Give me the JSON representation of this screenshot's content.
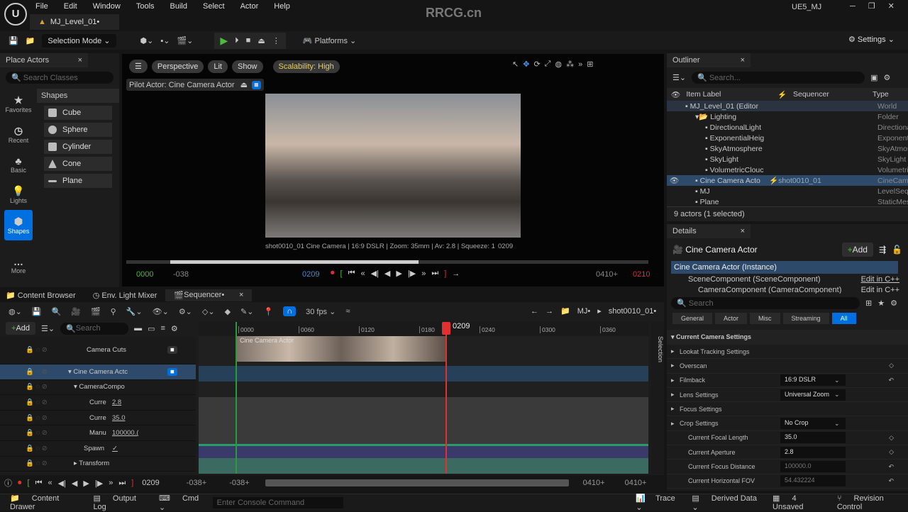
{
  "app": {
    "menus": [
      "File",
      "Edit",
      "Window",
      "Tools",
      "Build",
      "Select",
      "Actor",
      "Help"
    ],
    "level_tab": "MJ_Level_01•",
    "project": "UE5_MJ",
    "watermark": "RRCG.cn"
  },
  "toolbar": {
    "selection_mode": "Selection Mode",
    "platforms": "Platforms",
    "settings": "Settings"
  },
  "place_actors": {
    "title": "Place Actors",
    "search_placeholder": "Search Classes",
    "section": "Shapes",
    "categories": [
      "Favorites",
      "Recent",
      "Basic",
      "Lights",
      "Shapes",
      "More"
    ],
    "shapes": [
      "Cube",
      "Sphere",
      "Cylinder",
      "Cone",
      "Plane"
    ]
  },
  "viewport": {
    "perspective": "Perspective",
    "lit": "Lit",
    "show": "Show",
    "scalability": "Scalability: High",
    "pilot": "Pilot Actor: Cine Camera Actor",
    "overlay": "shot0010_01 Cine Camera | 16:9 DSLR | Zoom: 35mm | Av: 2.8 | Squeeze: 1",
    "overlay_frame": "0209",
    "start": "0000",
    "minus1": "-038",
    "current": "0209",
    "end_a": "0410+",
    "end_b": "0210"
  },
  "outliner": {
    "title": "Outliner",
    "search_placeholder": "Search...",
    "col_label": "Item Label",
    "col_seq": "Sequencer",
    "col_type": "Type",
    "rows": [
      {
        "label": "MJ_Level_01 (Editor",
        "type": "World",
        "indent": 1
      },
      {
        "label": "Lighting",
        "type": "Folder",
        "indent": 2
      },
      {
        "label": "DirectionalLight",
        "type": "Directiona",
        "indent": 3
      },
      {
        "label": "ExponentialHeig",
        "type": "Exponenti",
        "indent": 3
      },
      {
        "label": "SkyAtmosphere",
        "type": "SkyAtmos",
        "indent": 3
      },
      {
        "label": "SkyLight",
        "type": "SkyLight",
        "indent": 3
      },
      {
        "label": "VolumetricClouc",
        "type": "Volumetri",
        "indent": 3
      },
      {
        "label": "Cine Camera Acto",
        "seq": "shot0010_01",
        "type": "CineCame",
        "indent": 2,
        "selected": true
      },
      {
        "label": "MJ",
        "type": "LevelSequ",
        "indent": 2
      },
      {
        "label": "Plane",
        "type": "StaticMes",
        "indent": 2
      }
    ],
    "footer": "9 actors (1 selected)"
  },
  "details": {
    "title": "Details",
    "actor": "Cine Camera Actor",
    "add": "Add",
    "instance": "Cine Camera Actor (Instance)",
    "components": [
      {
        "name": "SceneComponent (SceneComponent)",
        "edit": "Edit in C++"
      },
      {
        "name": "CameraComponent (CameraComponent)",
        "edit": "Edit in C++"
      }
    ],
    "search_placeholder": "Search",
    "filters": [
      "General",
      "Actor",
      "Misc",
      "Streaming",
      "All"
    ],
    "active_filter": "All",
    "section": "Current Camera Settings",
    "props": [
      {
        "label": "Lookat Tracking Settings"
      },
      {
        "label": "Overscan"
      },
      {
        "label": "Filmback",
        "value": "16:9 DSLR"
      },
      {
        "label": "Lens Settings",
        "value": "Universal Zoom"
      },
      {
        "label": "Focus Settings"
      },
      {
        "label": "Crop Settings",
        "value": "No Crop"
      },
      {
        "label": "Current Focal Length",
        "value": "35.0"
      },
      {
        "label": "Current Aperture",
        "value": "2.8"
      },
      {
        "label": "Current Focus Distance",
        "value": "100000.0"
      },
      {
        "label": "Current Horizontal FOV",
        "value": "54.432224"
      }
    ]
  },
  "bottom_tabs": [
    "Content Browser",
    "Env. Light Mixer",
    "Sequencer•"
  ],
  "sequencer": {
    "fps": "30 fps",
    "breadcrumb_root": "MJ•",
    "breadcrumb_shot": "shot0010_01•",
    "add": "Add",
    "search_placeholder": "Search",
    "ticks": [
      "0000",
      "0060",
      "0120",
      "0180",
      "0240",
      "0300",
      "0360"
    ],
    "playhead": "0209",
    "clip_label": "Cine Camera Actor",
    "tracks": [
      {
        "label": "Camera Cuts"
      },
      {
        "label": "Cine Camera Actc"
      },
      {
        "label": "CameraCompo"
      },
      {
        "label": "Curre",
        "value": "2.8"
      },
      {
        "label": "Curre",
        "value": "35.0"
      },
      {
        "label": "Manu",
        "value": "100000.("
      },
      {
        "label": "Spawn",
        "value": "✓"
      },
      {
        "label": "Transform"
      }
    ],
    "frame": "0209",
    "in_a": "-038+",
    "in_b": "-038+",
    "out_a": "0410+",
    "out_b": "0410+",
    "side": "Selection"
  },
  "statusbar": {
    "content_drawer": "Content Drawer",
    "output_log": "Output Log",
    "cmd": "Cmd",
    "console_placeholder": "Enter Console Command",
    "trace": "Trace",
    "derived": "Derived Data",
    "unsaved": "4 Unsaved",
    "revision": "Revision Control"
  },
  "colors": {
    "accent": "#0070e0",
    "play": "#4cbb3c",
    "selected": "#2d4a6a",
    "playhead": "#e03030"
  }
}
